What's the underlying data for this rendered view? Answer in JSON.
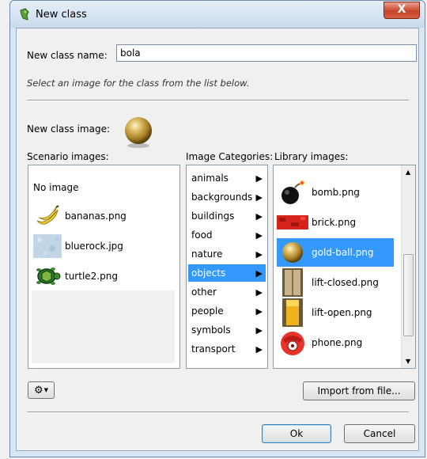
{
  "window": {
    "title": "New class",
    "close_glyph": "X"
  },
  "form": {
    "name_label": "New class name:",
    "name_value": "bola",
    "hint": "Select an image for the class from the list below.",
    "image_label": "New class image:"
  },
  "columns": {
    "scenario": "Scenario images:",
    "categories": "Image Categories:",
    "library": "Library images:"
  },
  "scenario_images": [
    {
      "label": "No image",
      "icon": "none"
    },
    {
      "label": "bananas.png",
      "icon": "bananas-icon"
    },
    {
      "label": "bluerock.jpg",
      "icon": "bluerock-icon"
    },
    {
      "label": "turtle2.png",
      "icon": "turtle-icon"
    }
  ],
  "categories": [
    {
      "label": "animals"
    },
    {
      "label": "backgrounds"
    },
    {
      "label": "buildings"
    },
    {
      "label": "food"
    },
    {
      "label": "nature"
    },
    {
      "label": "objects",
      "selected": true
    },
    {
      "label": "other"
    },
    {
      "label": "people"
    },
    {
      "label": "symbols"
    },
    {
      "label": "transport"
    }
  ],
  "library_images": [
    {
      "label": "bomb.png",
      "icon": "bomb-icon"
    },
    {
      "label": "brick.png",
      "icon": "brick-icon"
    },
    {
      "label": "gold-ball.png",
      "icon": "gold-ball-icon",
      "selected": true
    },
    {
      "label": "lift-closed.png",
      "icon": "lift-closed-icon"
    },
    {
      "label": "lift-open.png",
      "icon": "lift-open-icon"
    },
    {
      "label": "phone.png",
      "icon": "phone-icon"
    }
  ],
  "buttons": {
    "gear": "gear-icon",
    "import": "Import from file...",
    "ok": "Ok",
    "cancel": "Cancel"
  },
  "colors": {
    "selection": "#3399ff",
    "close": "#c7452a"
  }
}
